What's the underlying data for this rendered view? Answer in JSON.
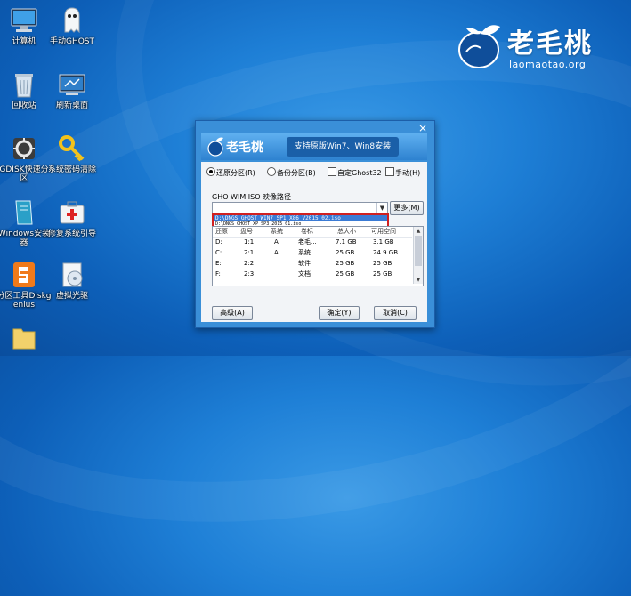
{
  "desktop_icons": [
    {
      "label": "计算机",
      "icon": "computer-icon"
    },
    {
      "label": "手动GHOST",
      "icon": "ghost-icon"
    },
    {
      "label": "回收站",
      "icon": "recycle-bin-icon"
    },
    {
      "label": "刷新桌面",
      "icon": "refresh-desktop-icon"
    },
    {
      "label": "GDISK快速分区",
      "icon": "gdisk-icon"
    },
    {
      "label": "系统密码清除",
      "icon": "key-icon"
    },
    {
      "label": "Windows安装器",
      "icon": "windows-installer-icon"
    },
    {
      "label": "修复系统引导",
      "icon": "medkit-icon"
    },
    {
      "label": "分区工具Diskgenius",
      "icon": "diskgenius-icon"
    },
    {
      "label": "虚拟光驱",
      "icon": "virtual-drive-icon"
    },
    {
      "label": "",
      "icon": "folder-icon"
    }
  ],
  "logo": {
    "brand": "老毛桃",
    "domain": "laomaotao.org"
  },
  "window": {
    "close": "×",
    "brand": "老毛桃",
    "tagline": "支持原版Win7、Win8安装",
    "options": {
      "restore": "还原分区(R)",
      "backup": "备份分区(B)",
      "custom_ghost": "自定Ghost32",
      "manual": "手动(H)",
      "selected": "restore"
    },
    "path_label": "GHO WIM ISO 映像路径",
    "combo_value": "",
    "more_button": "更多(M)",
    "dropdown": {
      "selected": "D:\\DNGS_GHOST_WIN7_SP1_X86_V2015_02.iso",
      "next": "D:\\DNGS_GHOST_XP_SP3_2015_01.iso"
    },
    "table": {
      "headers": [
        "还原",
        "盘号",
        "系统",
        "卷标",
        "总大小",
        "可用空间"
      ],
      "rows": [
        [
          "D:",
          "1:1",
          "A",
          "老毛...",
          "7.1 GB",
          "3.1 GB"
        ],
        [
          "C:",
          "2:1",
          "A",
          "系统",
          "25 GB",
          "24.9 GB"
        ],
        [
          "E:",
          "2:2",
          "",
          "软件",
          "25 GB",
          "25 GB"
        ],
        [
          "F:",
          "2:3",
          "",
          "文档",
          "25 GB",
          "25 GB"
        ]
      ]
    },
    "buttons": {
      "advanced": "高级(A)",
      "ok": "确定(Y)",
      "cancel": "取消(C)"
    }
  }
}
